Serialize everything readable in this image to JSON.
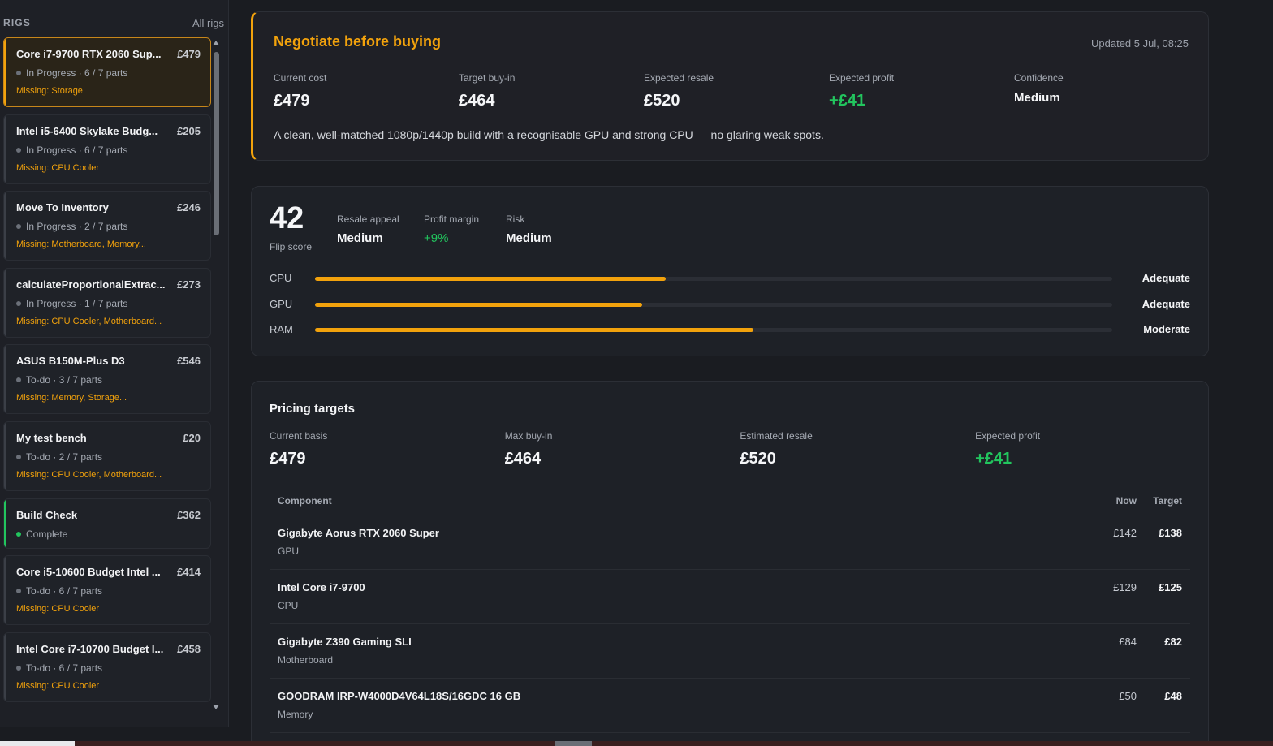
{
  "sidebar": {
    "title": "RIGS",
    "all_rigs_label": "All rigs",
    "items": [
      {
        "name": "Core i7-9700 RTX 2060 Sup...",
        "price": "£479",
        "status": "In Progress · 6 / 7 parts",
        "missing": "Missing: Storage"
      },
      {
        "name": "Intel i5-6400 Skylake Budg...",
        "price": "£205",
        "status": "In Progress · 6 / 7 parts",
        "missing": "Missing: CPU Cooler"
      },
      {
        "name": "Move To Inventory",
        "price": "£246",
        "status": "In Progress · 2 / 7 parts",
        "missing": "Missing: Motherboard, Memory..."
      },
      {
        "name": "calculateProportionalExtrac...",
        "price": "£273",
        "status": "In Progress · 1 / 7 parts",
        "missing": "Missing: CPU Cooler, Motherboard..."
      },
      {
        "name": "ASUS B150M-Plus D3",
        "price": "£546",
        "status": "To-do · 3 / 7 parts",
        "missing": "Missing: Memory, Storage..."
      },
      {
        "name": "My test bench",
        "price": "£20",
        "status": "To-do · 2 / 7 parts",
        "missing": "Missing: CPU Cooler, Motherboard..."
      },
      {
        "name": "Build Check",
        "price": "£362",
        "status": "Complete",
        "missing": ""
      },
      {
        "name": "Core i5-10600 Budget Intel ...",
        "price": "£414",
        "status": "To-do · 6 / 7 parts",
        "missing": "Missing: CPU Cooler"
      },
      {
        "name": "Intel Core i7-10700 Budget I...",
        "price": "£458",
        "status": "To-do · 6 / 7 parts",
        "missing": "Missing: CPU Cooler"
      }
    ]
  },
  "verdict": {
    "title": "Negotiate before buying",
    "updated": "Updated 5 Jul, 08:25",
    "metrics": [
      {
        "label": "Current cost",
        "value": "£479"
      },
      {
        "label": "Target buy-in",
        "value": "£464"
      },
      {
        "label": "Expected resale",
        "value": "£520"
      },
      {
        "label": "Expected profit",
        "value": "+£41"
      },
      {
        "label": "Confidence",
        "value": "Medium"
      }
    ],
    "description": "A clean, well-matched 1080p/1440p build with a recognisable GPU and strong CPU — no glaring weak spots."
  },
  "flip": {
    "score": "42",
    "score_label": "Flip score",
    "resale_appeal_label": "Resale appeal",
    "resale_appeal_value": "Medium",
    "profit_margin_label": "Profit margin",
    "profit_margin_value": "+9%",
    "risk_label": "Risk",
    "risk_value": "Medium",
    "bars": [
      {
        "label": "CPU",
        "fill": 0.44,
        "rating": "Adequate"
      },
      {
        "label": "GPU",
        "fill": 0.41,
        "rating": "Adequate"
      },
      {
        "label": "RAM",
        "fill": 0.55,
        "rating": "Moderate"
      }
    ]
  },
  "pricing": {
    "title": "Pricing targets",
    "metrics": [
      {
        "label": "Current basis",
        "value": "£479"
      },
      {
        "label": "Max buy-in",
        "value": "£464"
      },
      {
        "label": "Estimated resale",
        "value": "£520"
      },
      {
        "label": "Expected profit",
        "value": "+£41"
      }
    ],
    "columns": {
      "component": "Component",
      "now": "Now",
      "target": "Target"
    },
    "rows": [
      {
        "name": "Gigabyte Aorus RTX 2060 Super",
        "type": "GPU",
        "now": "£142",
        "target": "£138"
      },
      {
        "name": "Intel Core i7-9700",
        "type": "CPU",
        "now": "£129",
        "target": "£125"
      },
      {
        "name": "Gigabyte Z390 Gaming SLI",
        "type": "Motherboard",
        "now": "£84",
        "target": "£82"
      },
      {
        "name": "GOODRAM IRP-W4000D4V64L18S/16GDC 16 GB",
        "type": "Memory",
        "now": "£50",
        "target": "£48"
      }
    ]
  },
  "colors": {
    "accent": "#f2a20c",
    "profit": "#22c55e",
    "background": "#1a1c21"
  }
}
